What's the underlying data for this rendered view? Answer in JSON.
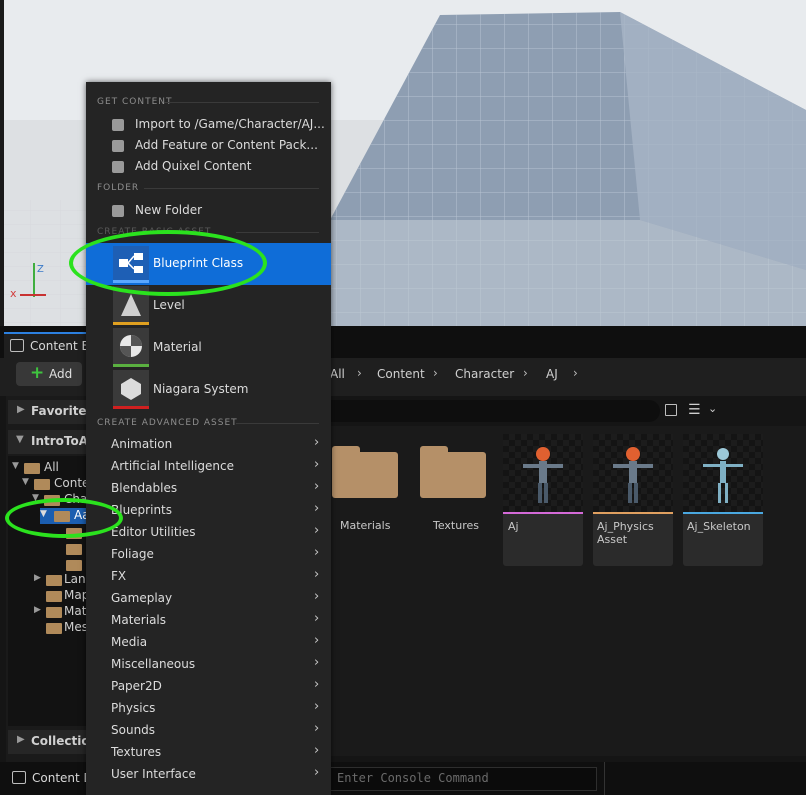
{
  "viewport": {
    "axis_z": "Z",
    "axis_x": "x"
  },
  "panel": {
    "tab_title": "Content B",
    "add_button": "Add"
  },
  "breadcrumb": [
    "All",
    "Content",
    "Character",
    "AJ"
  ],
  "left_panel": {
    "favorites": "Favorites",
    "project": "IntroToAr",
    "collections": "Collection"
  },
  "tree": {
    "items": [
      "All",
      "Conte",
      "Cha",
      "Aa",
      "Lan",
      "Map",
      "Mat",
      "Mes"
    ]
  },
  "assets": [
    {
      "label": "Materials",
      "type": "folder"
    },
    {
      "label": "Textures",
      "type": "folder"
    },
    {
      "label": "Aj",
      "type": "skeletal-mesh",
      "color": "#d46ad8"
    },
    {
      "label": "Aj_Physics\nAsset",
      "type": "physics-asset",
      "color": "#e0a060"
    },
    {
      "label": "Aj_Skeleton",
      "type": "skeleton",
      "color": "#4aa8e0"
    }
  ],
  "bottom_bar": {
    "content_drawer": "Content D",
    "console_placeholder": "Enter Console Command"
  },
  "menu": {
    "get_content_header": "GET CONTENT",
    "get_content_items": [
      "Import to /Game/Character/AJ...",
      "Add Feature or Content Pack...",
      "Add Quixel Content"
    ],
    "folder_header": "FOLDER",
    "new_folder": "New Folder",
    "create_basic_header": "CREATE BASIC ASSET",
    "basic_assets": [
      {
        "label": "Blueprint Class",
        "color": "#1e6fd0"
      },
      {
        "label": "Level",
        "color": "#e0a020"
      },
      {
        "label": "Material",
        "color": "#5ab040"
      },
      {
        "label": "Niagara System",
        "color": "#d02020"
      }
    ],
    "advanced_header": "CREATE ADVANCED ASSET",
    "advanced_items": [
      "Animation",
      "Artificial Intelligence",
      "Blendables",
      "Blueprints",
      "Editor Utilities",
      "Foliage",
      "FX",
      "Gameplay",
      "Materials",
      "Media",
      "Miscellaneous",
      "Paper2D",
      "Physics",
      "Sounds",
      "Textures",
      "User Interface"
    ]
  },
  "highlight_color": "#2be21e"
}
